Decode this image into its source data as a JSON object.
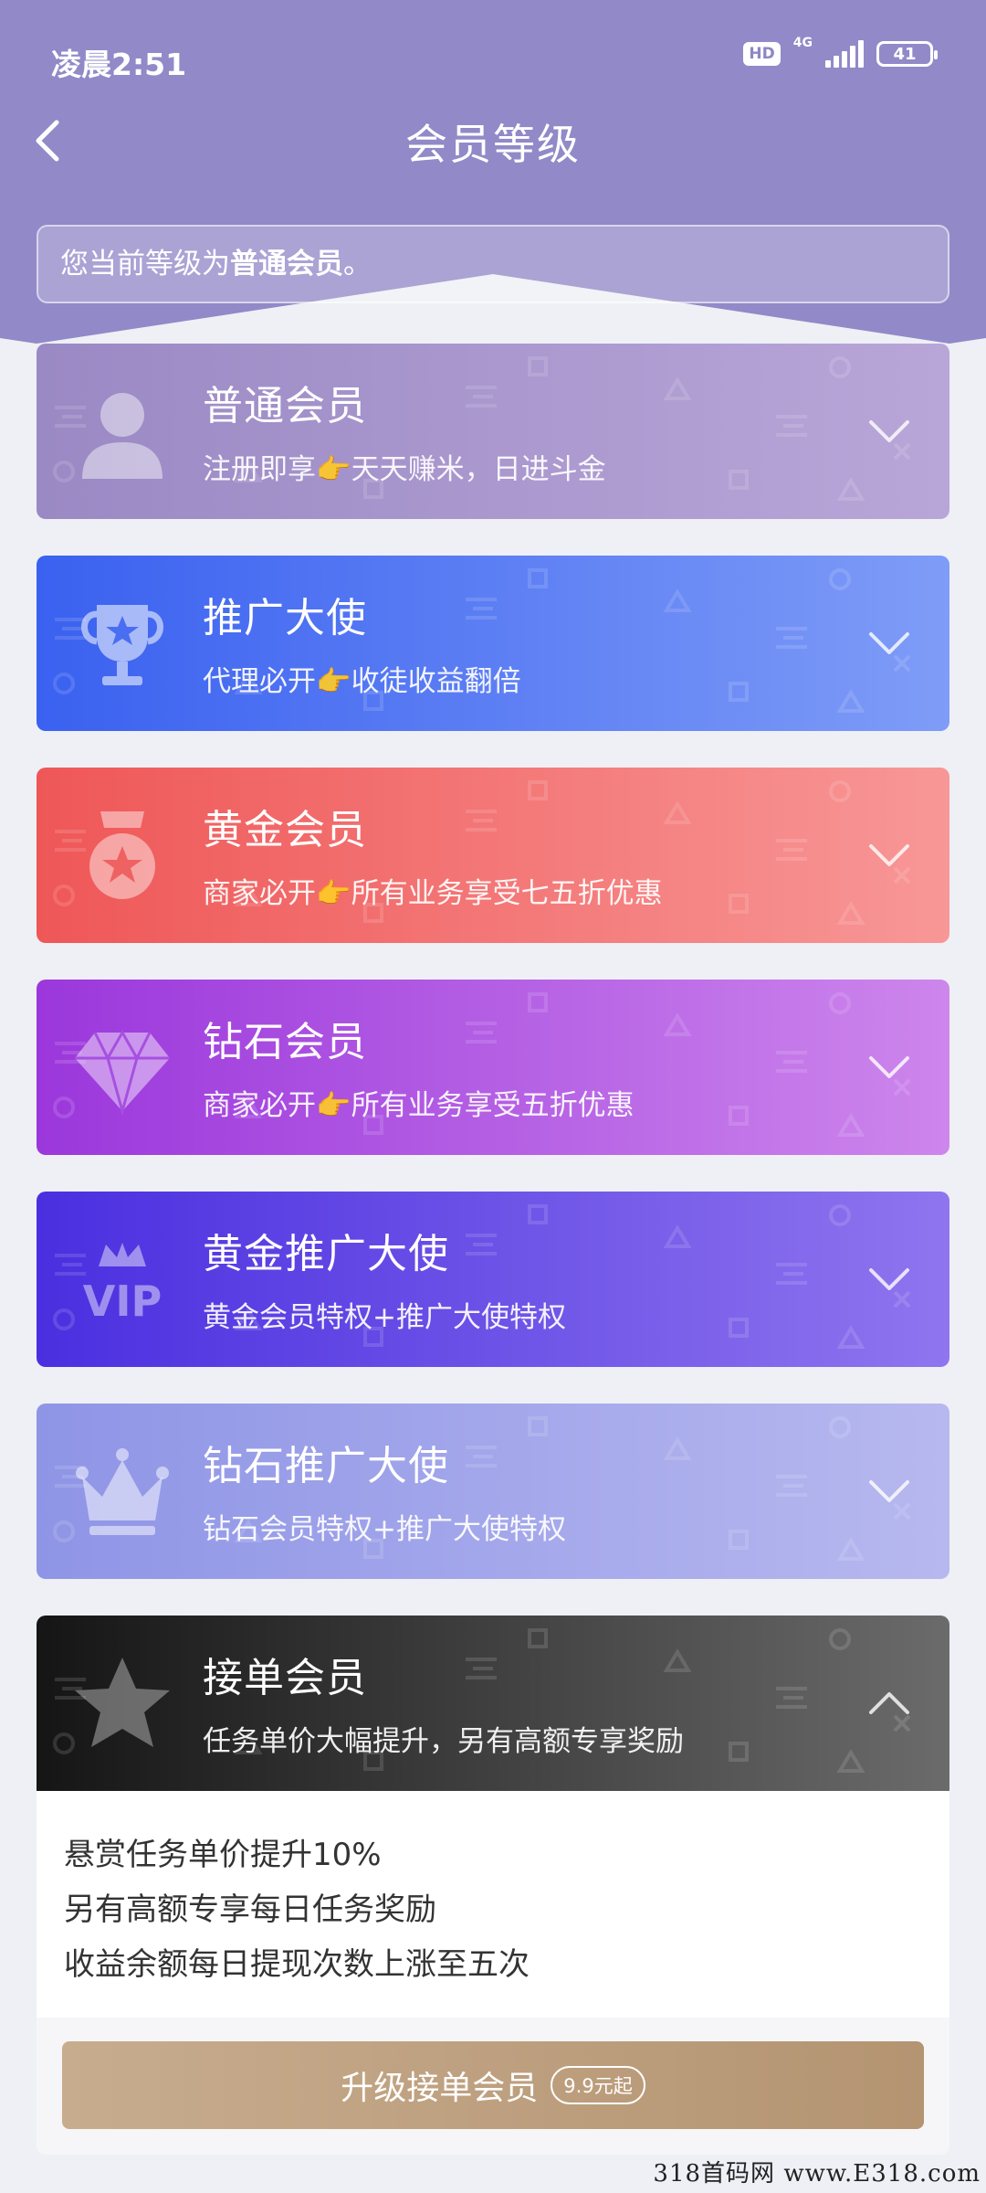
{
  "status_bar": {
    "time": "凌晨2:51",
    "hd": "HD",
    "network": "4G",
    "battery": "41"
  },
  "header": {
    "title": "会员等级",
    "back_icon": "chevron-left-icon"
  },
  "current_level": {
    "prefix": "您当前等级为",
    "level": "普通会员",
    "suffix": "。"
  },
  "levels": [
    {
      "title": "普通会员",
      "desc": "注册即享👉天天赚米，日进斗金",
      "icon": "person-icon",
      "expanded": false,
      "colors": [
        "#9a89c4",
        "#b9a6d8"
      ]
    },
    {
      "title": "推广大使",
      "desc": "代理必开👉收徒收益翻倍",
      "icon": "trophy-icon",
      "expanded": false,
      "colors": [
        "#3a61f0",
        "#7f9cf7"
      ]
    },
    {
      "title": "黄金会员",
      "desc": "商家必开👉所有业务享受七五折优惠",
      "icon": "medal-icon",
      "expanded": false,
      "colors": [
        "#ef5757",
        "#f89797"
      ]
    },
    {
      "title": "钻石会员",
      "desc": "商家必开👉所有业务享受五折优惠",
      "icon": "diamond-icon",
      "expanded": false,
      "colors": [
        "#9b37dc",
        "#cd86ec"
      ]
    },
    {
      "title": "黄金推广大使",
      "desc": "黄金会员特权+推广大使特权",
      "icon": "vip-crown-icon",
      "expanded": false,
      "colors": [
        "#4a2fe0",
        "#8f75ee"
      ]
    },
    {
      "title": "钻石推广大使",
      "desc": "钻石会员特权+推广大使特权",
      "icon": "crown-icon",
      "expanded": false,
      "colors": [
        "#8f95e6",
        "#b7b8ef"
      ]
    },
    {
      "title": "接单会员",
      "desc": "任务单价大幅提升，另有高额专享奖励",
      "icon": "star-icon",
      "expanded": true,
      "colors": [
        "#151515",
        "#6b6b6b"
      ]
    }
  ],
  "details": {
    "lines": [
      "悬赏任务单价提升10%",
      "另有高额专享每日任务奖励",
      "收益余额每日提现次数上涨至五次"
    ]
  },
  "upgrade": {
    "label": "升级接单会员",
    "price": "9.9元起"
  },
  "watermark": "318首码网 www.E318.com"
}
